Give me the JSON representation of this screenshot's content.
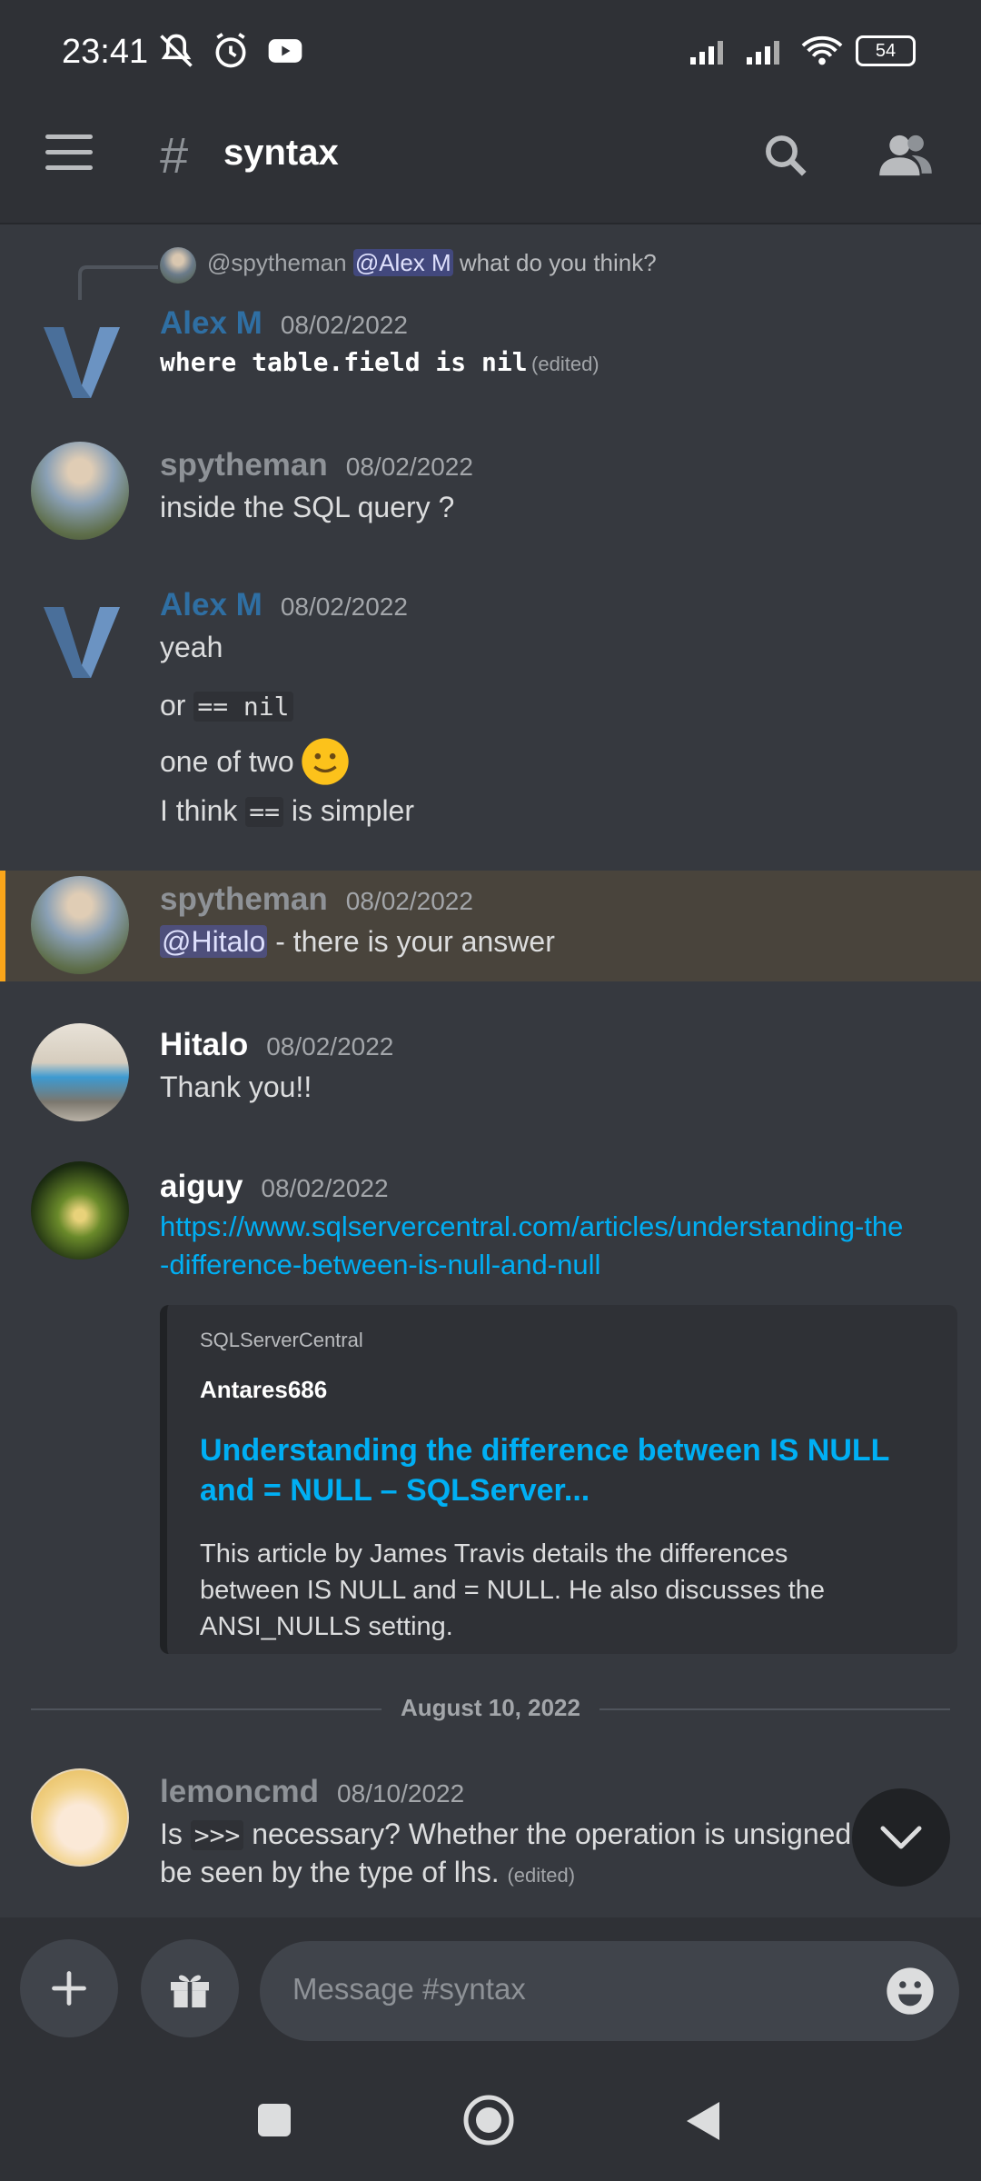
{
  "status_bar": {
    "time": "23:41",
    "battery": "54"
  },
  "header": {
    "channel_name": "syntax"
  },
  "messages": {
    "reply": {
      "user": "@spytheman",
      "mention": "@Alex M",
      "text": "what do you think?"
    },
    "m1": {
      "author": "Alex M",
      "timestamp": "08/02/2022",
      "code": "where table.field is nil",
      "edited": "(edited)"
    },
    "m2": {
      "author": "spytheman",
      "timestamp": "08/02/2022",
      "text": "inside the SQL query ?"
    },
    "m3": {
      "author": "Alex M",
      "timestamp": "08/02/2022",
      "line1": "yeah",
      "line2_prefix": "or",
      "line2_code": "== nil",
      "line3": "one of two",
      "line4_prefix": "I think",
      "line4_code": "==",
      "line4_suffix": "is simpler"
    },
    "m4": {
      "author": "spytheman",
      "timestamp": "08/02/2022",
      "mention": "@Hitalo",
      "text": "- there is your answer"
    },
    "m5": {
      "author": "Hitalo",
      "timestamp": "08/02/2022",
      "text": "Thank you!!"
    },
    "m6": {
      "author": "aiguy",
      "timestamp": "08/02/2022",
      "link_line1": "https://www.sqlservercentral.com/articles/understanding-the",
      "link_line2": "-difference-between-is-null-and-null",
      "embed": {
        "provider": "SQLServerCentral",
        "author": "Antares686",
        "title_line1": "Understanding the difference between IS NULL",
        "title_line2": "and = NULL – SQLServer...",
        "desc_line1": "This article by James Travis details the differences",
        "desc_line2": "between IS NULL and = NULL. He also discusses the",
        "desc_line3": "ANSI_NULLS setting."
      }
    },
    "date_divider": "August 10, 2022",
    "m7": {
      "author": "lemoncmd",
      "timestamp": "08/10/2022",
      "line1_prefix": "Is",
      "line1_code": ">>>",
      "line1_suffix": "necessary? Whether the operation is unsigned or",
      "line2": "be seen by the type of lhs.",
      "edited": "(edited)"
    }
  },
  "composer": {
    "placeholder": "Message #syntax"
  },
  "colors": {
    "background": "#36393f",
    "alex_name": "#2f6fa3",
    "spytheman_name": "#8e9297",
    "link": "#00aff4",
    "highlight": "#49443c",
    "highlight_bar": "#faa61a"
  }
}
